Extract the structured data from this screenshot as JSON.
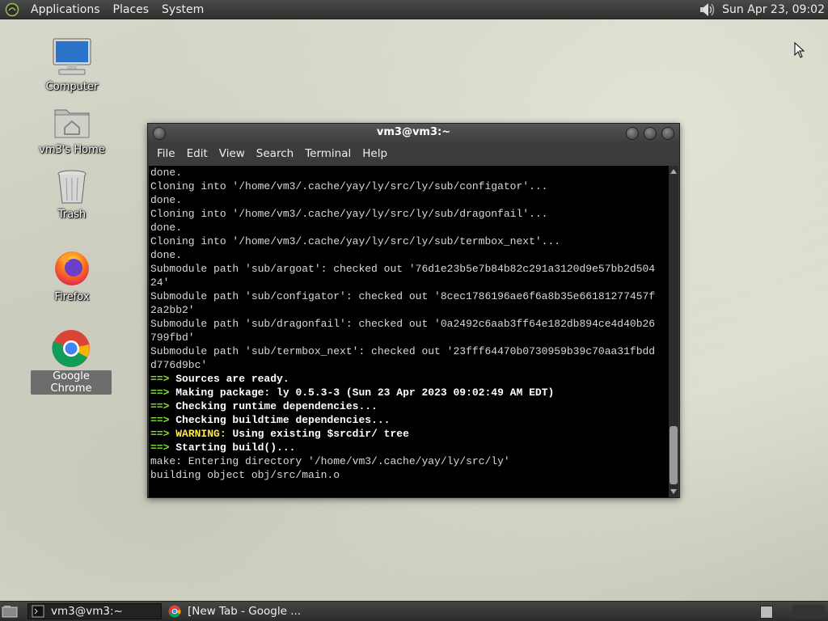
{
  "top_panel": {
    "menus": [
      "Applications",
      "Places",
      "System"
    ],
    "clock": "Sun Apr 23, 09:02"
  },
  "desktop_icons": [
    {
      "label": "Computer",
      "icon": "computer-icon"
    },
    {
      "label": "vm3's Home",
      "icon": "home-folder-icon"
    },
    {
      "label": "Trash",
      "icon": "trash-icon"
    },
    {
      "label": "Firefox",
      "icon": "firefox-icon"
    },
    {
      "label": "Google Chrome",
      "icon": "chrome-icon"
    }
  ],
  "window": {
    "title": "vm3@vm3:~",
    "menus": [
      "File",
      "Edit",
      "View",
      "Search",
      "Terminal",
      "Help"
    ]
  },
  "terminal": {
    "lines": [
      "done.",
      "Cloning into '/home/vm3/.cache/yay/ly/src/ly/sub/configator'...",
      "done.",
      "Cloning into '/home/vm3/.cache/yay/ly/src/ly/sub/dragonfail'...",
      "done.",
      "Cloning into '/home/vm3/.cache/yay/ly/src/ly/sub/termbox_next'...",
      "done.",
      "Submodule path 'sub/argoat': checked out '76d1e23b5e7b84b82c291a3120d9e57bb2d504",
      "24'",
      "Submodule path 'sub/configator': checked out '8cec1786196ae6f6a8b35e66181277457f",
      "2a2bb2'",
      "Submodule path 'sub/dragonfail': checked out '0a2492c6aab3ff64e182db894ce4d40b26",
      "799fbd'",
      "Submodule path 'sub/termbox_next': checked out '23fff64470b0730959b39c70aa31fbdd",
      "d776d9bc'"
    ],
    "build_lines": [
      {
        "arrow": "==>",
        "prefix": "",
        "text": "Sources are ready."
      },
      {
        "arrow": "==>",
        "prefix": "",
        "text": "Making package: ly 0.5.3-3 (Sun 23 Apr 2023 09:02:49 AM EDT)"
      },
      {
        "arrow": "==>",
        "prefix": "",
        "text": "Checking runtime dependencies..."
      },
      {
        "arrow": "==>",
        "prefix": "",
        "text": "Checking buildtime dependencies..."
      },
      {
        "arrow": "==>",
        "prefix": "WARNING:",
        "text": "Using existing $srcdir/ tree"
      },
      {
        "arrow": "==>",
        "prefix": "",
        "text": "Starting build()..."
      }
    ],
    "tail_lines": [
      "make: Entering directory '/home/vm3/.cache/yay/ly/src/ly'",
      "building object obj/src/main.o"
    ]
  },
  "taskbar": {
    "tasks": [
      {
        "label": "vm3@vm3:~",
        "active": true
      },
      {
        "label": "[New Tab - Google ...",
        "active": false
      }
    ]
  }
}
